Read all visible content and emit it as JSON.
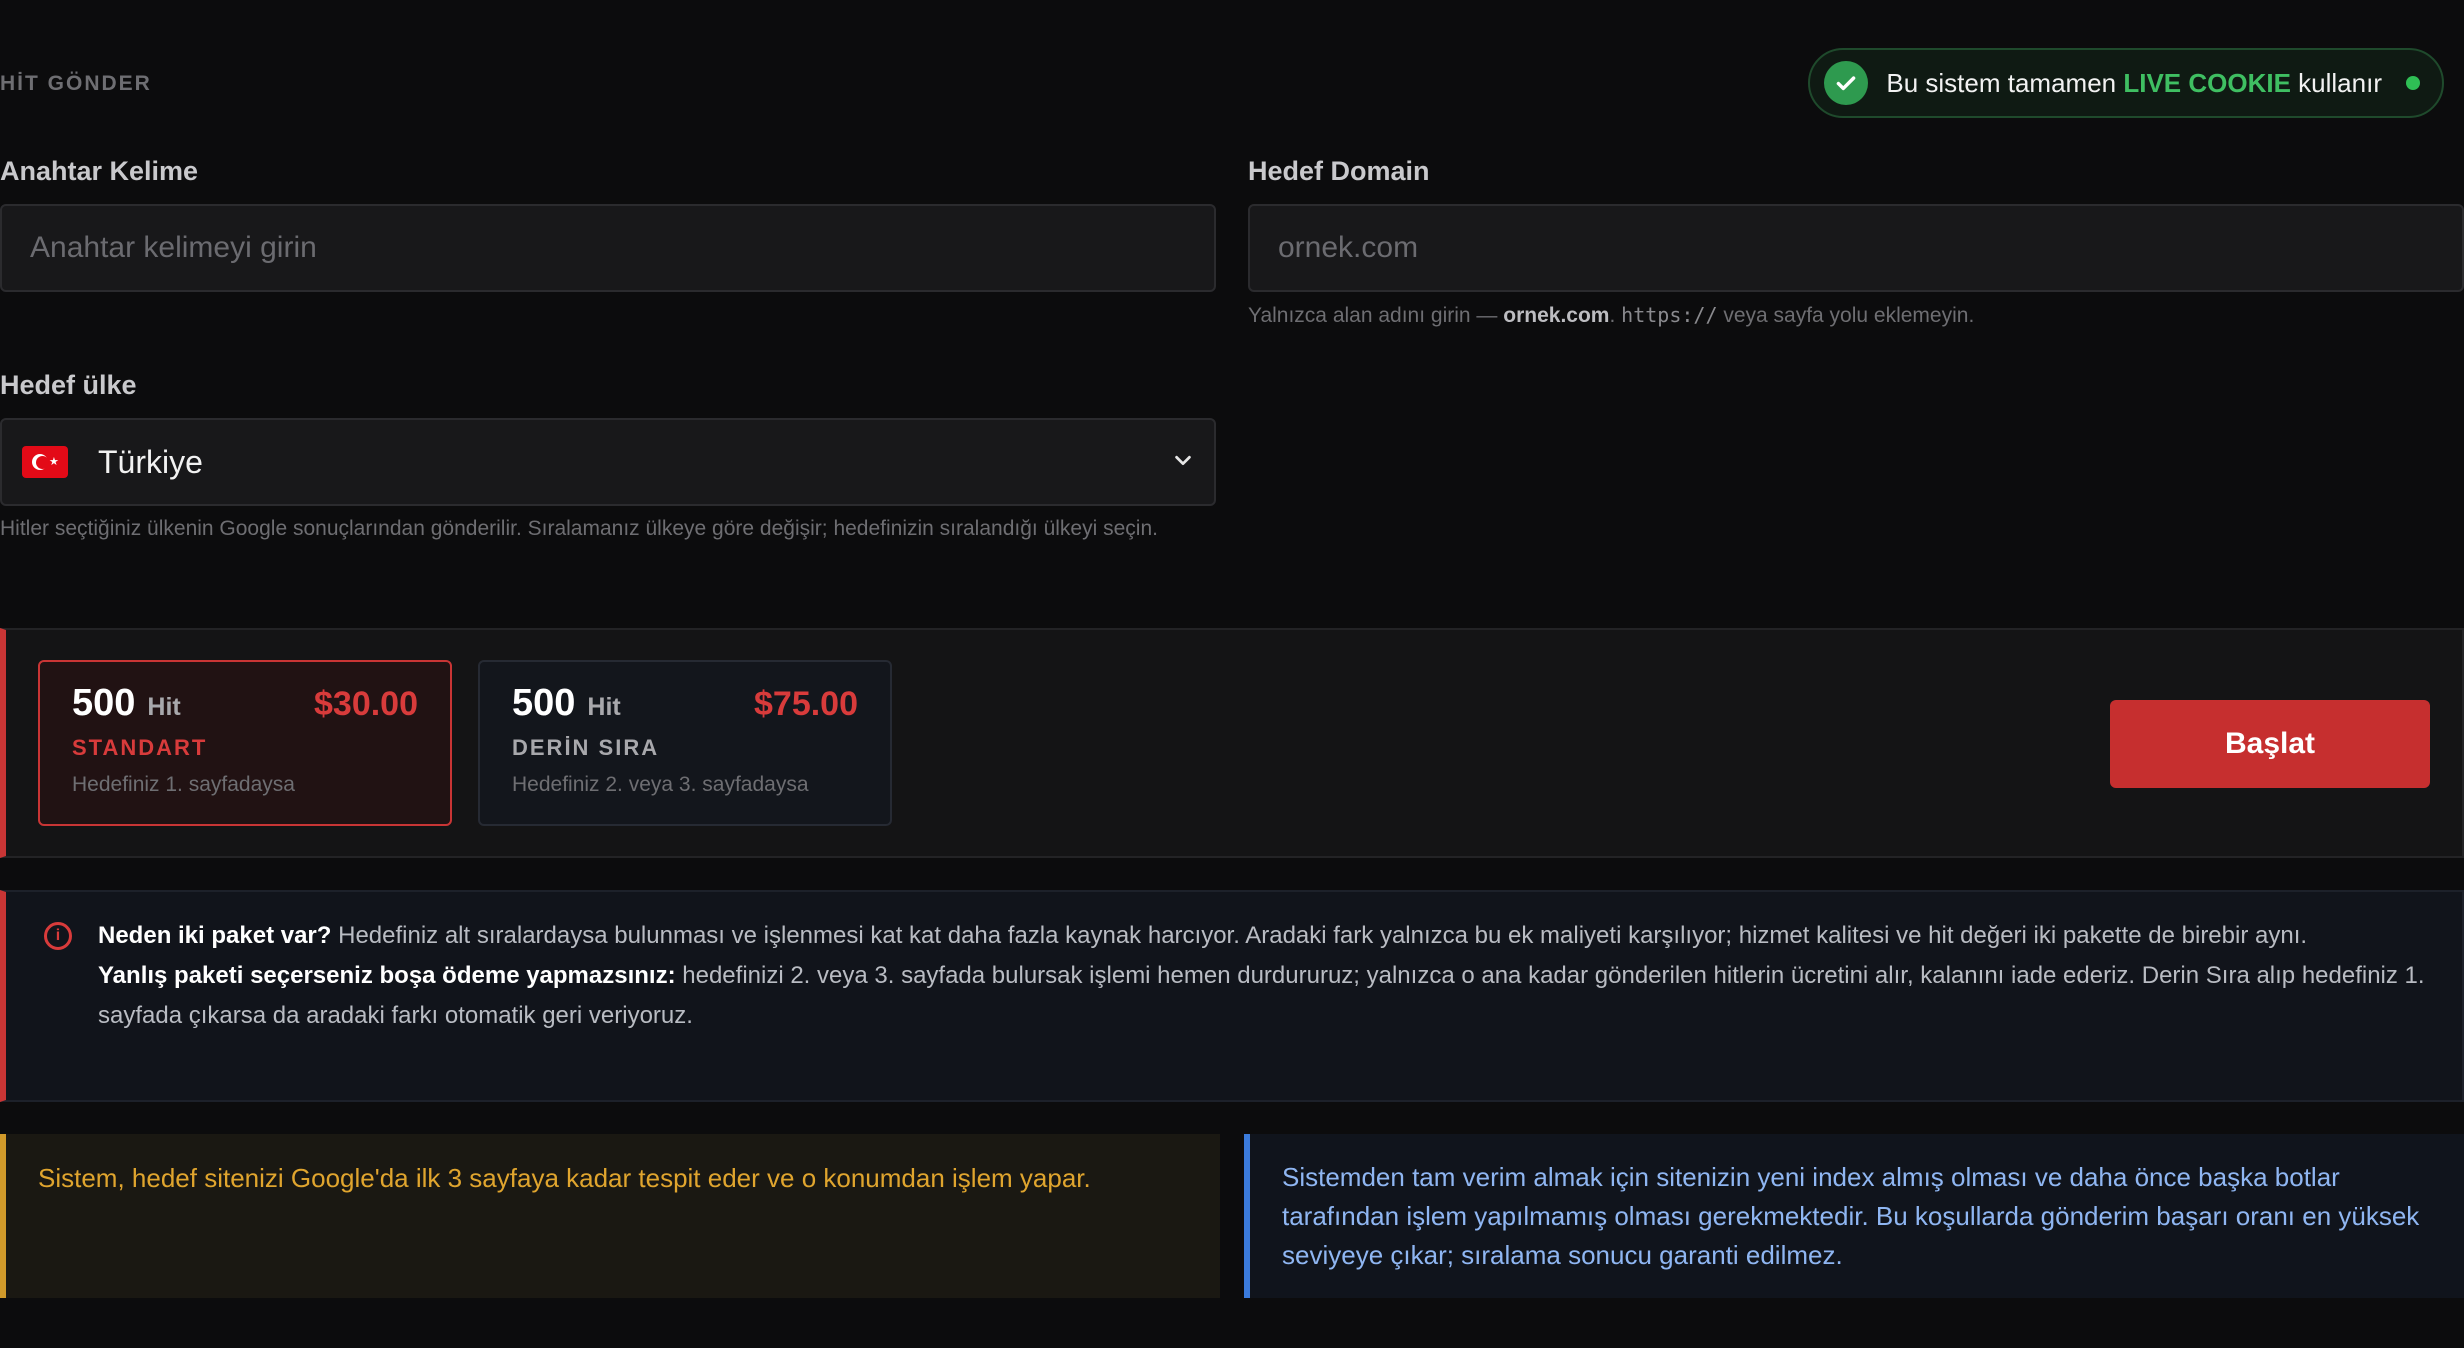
{
  "header": {
    "section_label": "HİT GÖNDER",
    "badge": {
      "prefix": "Bu sistem tamamen",
      "highlight": "LIVE COOKIE",
      "suffix": "kullanır"
    }
  },
  "form": {
    "keyword": {
      "label": "Anahtar Kelime",
      "placeholder": "Anahtar kelimeyi girin",
      "value": ""
    },
    "domain": {
      "label": "Hedef Domain",
      "placeholder": "ornek.com",
      "value": "",
      "hint_a": "Yalnızca alan adını girin —",
      "hint_bold": "ornek.com",
      "hint_b": ".",
      "hint_code": "https://",
      "hint_c": "veya sayfa yolu eklemeyin."
    },
    "country": {
      "label": "Hedef ülke",
      "selected": "Türkiye",
      "hint": "Hitler seçtiğiniz ülkenin Google sonuçlarından gönderilir. Sıralamanız ülkeye göre değişir; hedefinizin sıralandığı ülkeyi seçin."
    }
  },
  "packages": [
    {
      "count": "500",
      "unit": "Hit",
      "price": "$30.00",
      "name": "STANDART",
      "desc": "Hedefiniz 1. sayfadaysa",
      "selected": true
    },
    {
      "count": "500",
      "unit": "Hit",
      "price": "$75.00",
      "name": "DERİN SIRA",
      "desc": "Hedefiniz 2. veya 3. sayfadaysa",
      "selected": false
    }
  ],
  "start_label": "Başlat",
  "info": {
    "q1": "Neden iki paket var?",
    "a1": "Hedefiniz alt sıralardaysa bulunması ve işlenmesi kat kat daha fazla kaynak harcıyor. Aradaki fark yalnızca bu ek maliyeti karşılıyor; hizmet kalitesi ve hit değeri iki pakette de birebir aynı.",
    "q2": "Yanlış paketi seçerseniz boşa ödeme yapmazsınız:",
    "a2": "hedefinizi 2. veya 3. sayfada bulursak işlemi hemen durdururuz; yalnızca o ana kadar gönderilen hitlerin ücretini alır, kalanını iade ederiz. Derin Sıra alıp hedefiniz 1. sayfada çıkarsa da aradaki farkı otomatik geri veriyoruz."
  },
  "notes": {
    "warning": "Sistem, hedef sitenizi Google'da ilk 3 sayfaya kadar tespit eder ve o konumdan işlem yapar.",
    "tip": "Sistemden tam verim almak için sitenizin yeni index almış olması ve daha önce başka botlar tarafından işlem yapılmamış olması gerekmektedir. Bu koşullarda gönderim başarı oranı en yüksek seviyeye çıkar; sıralama sonucu garanti edilmez."
  },
  "colors": {
    "accent_red": "#c62f2f",
    "live_green": "#3fbf62",
    "warning_amber": "#e0a52e",
    "tip_blue": "#8fb6f2"
  },
  "icons": {
    "badge": "check-circle-icon",
    "info": "info-circle-icon",
    "select": "chevron-down-icon",
    "flag": "turkey-flag-icon"
  }
}
